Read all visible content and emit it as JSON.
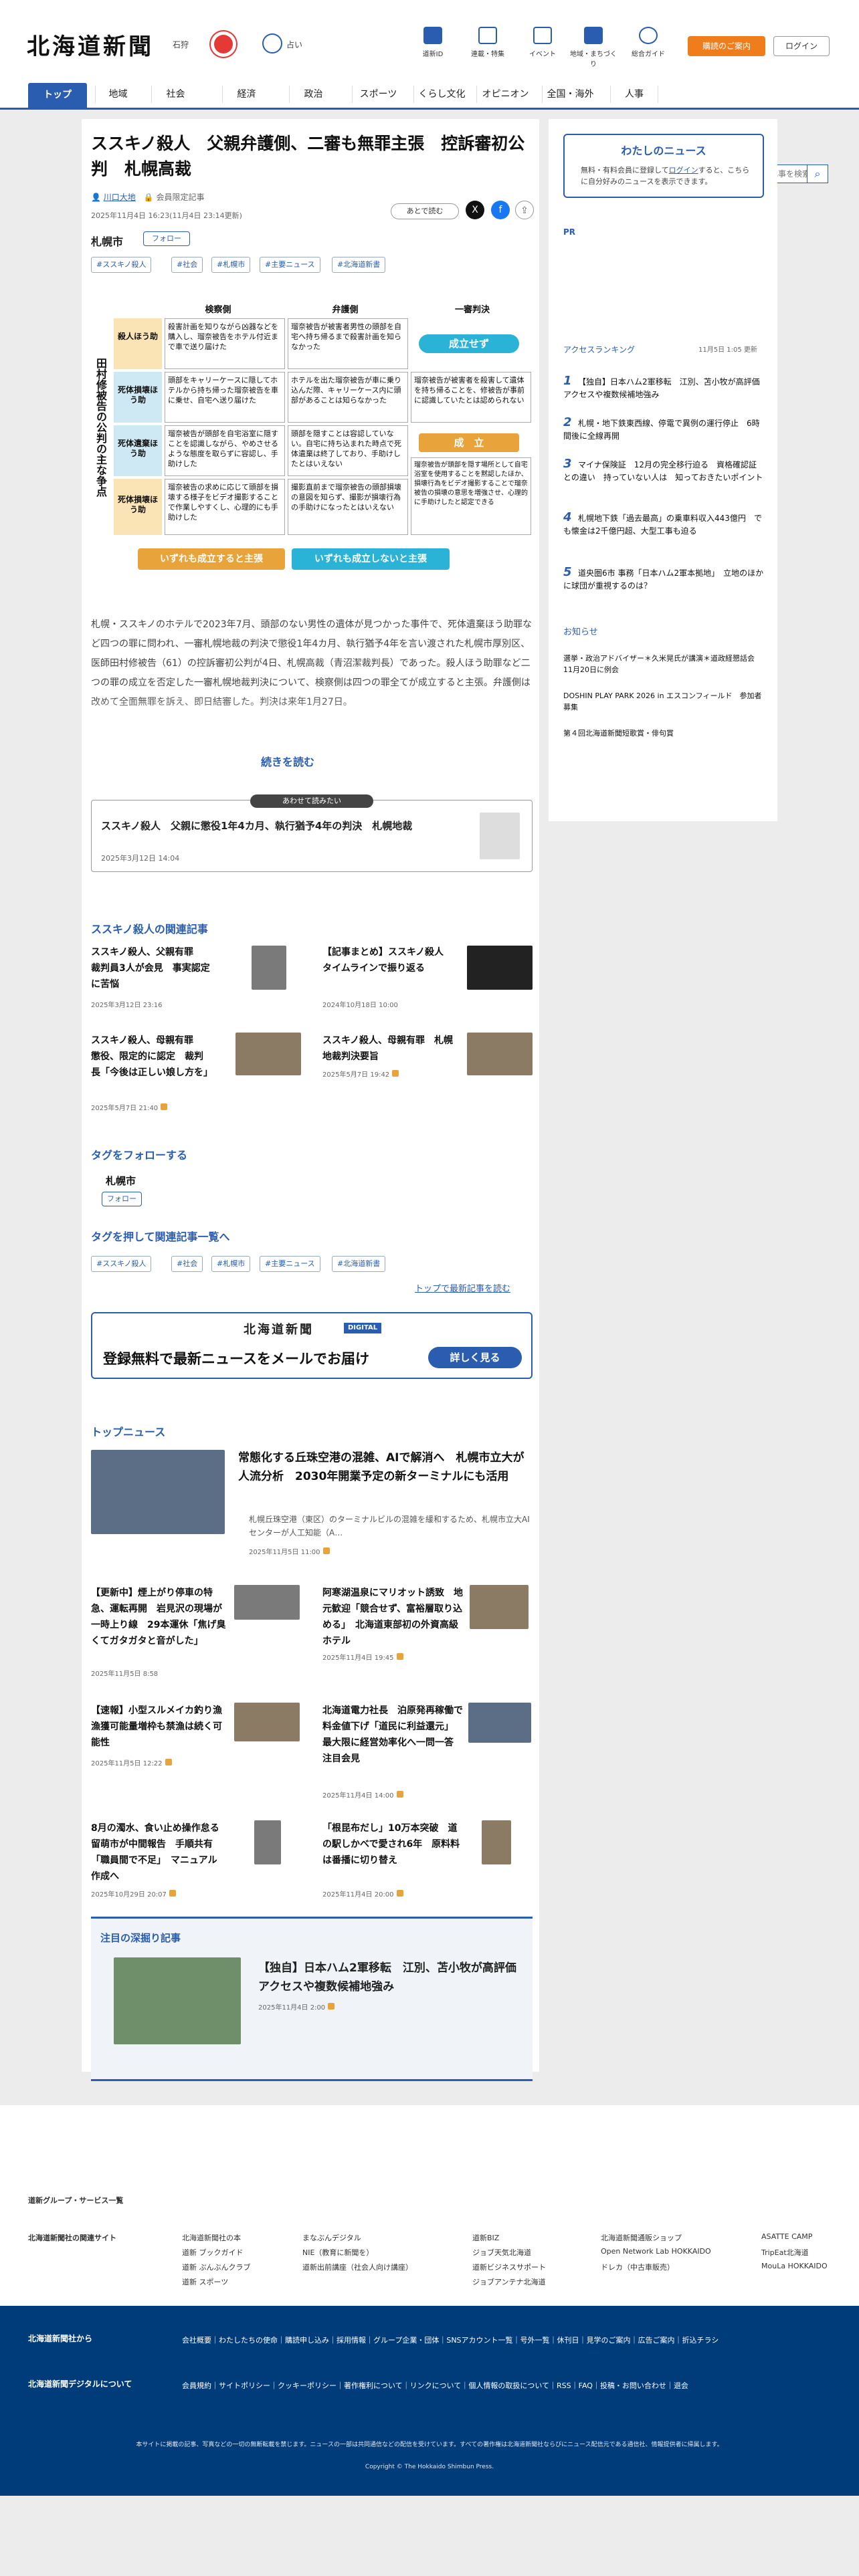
{
  "header": {
    "logo": "北海道新聞",
    "region": "石狩",
    "fortune": "占い",
    "nav": [
      "道新ID",
      "連載・特集",
      "イベント",
      "地域・まちづくり",
      "総合ガイド"
    ],
    "subscribe": "購読のご案内",
    "login": "ログイン"
  },
  "gnav": {
    "items": [
      "トップ",
      "地域",
      "社会",
      "経済",
      "政治",
      "スポーツ",
      "くらし文化",
      "オピニオン",
      "全国・海外",
      "人事"
    ],
    "search_placeholder": "記事を検索"
  },
  "article": {
    "title": "ススキノ殺人　父親弁護側、二審も無罪主張　控訴審初公判　札幌高裁",
    "author": "川口大地",
    "members": "会員限定記事",
    "date": "2025年11月4日 16:23(11月4日 23:14更新)",
    "read_later": "あとで読む",
    "city": "札幌市",
    "follow": "フォロー",
    "tags": [
      "#ススキノ殺人",
      "#社会",
      "#札幌市",
      "#主要ニュース",
      "#北海道新書"
    ],
    "table": {
      "side": "田村修被告の公判の主な争点",
      "cols": [
        "検察側",
        "弁護側",
        "一審判決"
      ],
      "rows": [
        {
          "label": "殺人ほう助",
          "pros": "殺害計画を知りながら凶器などを購入し、瑠奈被告をホテル付近まで車で送り届けた",
          "def": "瑠奈被告が被害者男性の頭部を自宅へ持ち帰るまで殺害計画を知らなかった",
          "ruling": "成立せず"
        },
        {
          "label": "死体損壊ほう助",
          "pros": "頭部をキャリーケースに隠してホテルから持ち帰った瑠奈被告を車に乗せ、自宅へ送り届けた",
          "def": "ホテルを出た瑠奈被告が車に乗り込んだ際、キャリーケース内に頭部があることは知らなかった",
          "ruling": "瑠奈被告が被害者を殺害して遺体を持ち帰ることを、修被告が事前に認識していたとは認められない"
        },
        {
          "label": "死体遺棄ほう助",
          "pros": "瑠奈被告が頭部を自宅浴室に隠すことを認識しながら、やめさせるような態度を取らずに容認し、手助けした",
          "def": "頭部を隠すことは容認していない。自宅に持ち込まれた時点で死体遺棄は終了しており、手助けしたとはいえない",
          "ruling": "成　立"
        },
        {
          "label": "死体損壊ほう助",
          "pros": "瑠奈被告の求めに応じて頭部を損壊する様子をビデオ撮影することで作業しやすくし、心理的にも手助けした",
          "def": "撮影直前まで瑠奈被告の頭部損壊の意図を知らず、撮影が損壊行為の手助けになったとはいえない",
          "ruling": "瑠奈被告が頭部を隠す場所として自宅浴室を使用することを黙認したほか、損壊行為をビデオ撮影することで瑠奈被告の損壊の意思を増強させ、心理的に手助けしたと認定できる"
        }
      ],
      "footer": [
        "いずれも成立すると主張",
        "いずれも成立しないと主張"
      ]
    },
    "body": "札幌・ススキノのホテルで2023年7月、頭部のない男性の遺体が見つかった事件で、死体遺棄ほう助罪など四つの罪に問われ、一審札幌地裁の判決で懲役1年4カ月、執行猶予4年を言い渡された札幌市厚別区、医師田村修被告（61）の控訴審初公判が4日、札幌高裁（青沼潔裁判長）であった。殺人ほう助罪など二つの罪の成立を否定した一審札幌地裁判決について、検察側は四つの罪全てが成立すると主張。弁護側は改めて全面無罪を訴え、即日結審した。判決は来年1月27日。",
    "read_more": "続きを読む"
  },
  "recommend": {
    "label": "あわせて読みたい",
    "title": "ススキノ殺人　父親に懲役1年4カ月、執行猶予4年の判決　札幌地裁",
    "date": "2025年3月12日 14:04"
  },
  "related": {
    "heading": "ススキノ殺人の関連記事",
    "items": [
      {
        "title": "ススキノ殺人、父親有罪　裁判員3人が会見　事実認定に苦悩",
        "date": "2025年3月12日 23:16"
      },
      {
        "title": "【記事まとめ】ススキノ殺人　タイムラインで振り返る",
        "date": "2024年10月18日 10:00"
      },
      {
        "title": "ススキノ殺人、母親有罪　懲役、限定的に認定　裁判長「今後は正しい娘し方を」",
        "date": "2025年5月7日 21:40"
      },
      {
        "title": "ススキノ殺人、母親有罪　札幌地裁判決要旨",
        "date": "2025年5月7日 19:42"
      }
    ]
  },
  "tagfollow": {
    "heading": "タグをフォローする",
    "city": "札幌市",
    "follow": "フォロー",
    "heading2": "タグを押して関連記事一覧へ",
    "back": "トップで最新記事を読む"
  },
  "banner": {
    "logo": "北海道新聞",
    "badge": "DIGITAL",
    "text": "登録無料で最新ニュースをメールでお届け",
    "btn": "詳しく見る"
  },
  "top": {
    "heading": "トップニュース",
    "lead": {
      "title": "常態化する丘珠空港の混雑、AIで解消へ　札幌市立大が人流分析　2030年開業予定の新ターミナルにも活用",
      "excerpt": "札幌丘珠空港（東区）のターミナルビルの混雑を緩和するため、札幌市立大AIセンターが人工知能（A…",
      "date": "2025年11月5日 11:00"
    },
    "items": [
      {
        "title": "【更新中】煙上がり停車の特急、運転再開　岩見沢の現場が一時上り線　29本運休「焦げ臭くてガタガタと音がした」",
        "date": "2025年11月5日 8:58"
      },
      {
        "title": "阿寒湖温泉にマリオット誘致　地元歓迎「競合せず、富裕層取り込める」　北海道東部初の外資高級ホテル",
        "date": "2025年11月4日 19:45"
      },
      {
        "title": "【速報】小型スルメイカ釣り漁　漁獲可能量増枠も禁漁は続く可能性",
        "date": "2025年11月5日 12:22"
      },
      {
        "title": "北海道電力社長　泊原発再稼働で料金値下げ「道民に利益還元」　最大限に経営効率化へ一問一答　注目会見",
        "date": "2025年11月4日 14:00"
      },
      {
        "title": "8月の濁水、食い止め操作怠る　留萌市が中間報告　手順共有「職員間で不足」　マニュアル作成へ",
        "date": "2025年10月29日 20:07"
      },
      {
        "title": "「根昆布だし」10万本突破　道の駅しかべで愛され6年　原料料は番播に切り替え",
        "date": "2025年11月4日 20:00"
      }
    ]
  },
  "deep": {
    "heading": "注目の深掘り記事",
    "title": "【独自】日本ハム2軍移転　江別、苫小牧が高評価　アクセスや複数候補地強み",
    "date": "2025年11月4日 2:00"
  },
  "side": {
    "mynews": "わたしのニュース",
    "mynews_text": "無料・有料会員に登録して",
    "login": "ログイン",
    "mynews_text2": "すると、こちらに自分好みのニュースを表示できます。",
    "pr": "PR",
    "ranking": "アクセスランキング",
    "ranking_date": "11月5日 1:05 更新",
    "ranks": [
      "【独自】日本ハム2軍移転　江別、苫小牧が高評価　アクセスや複数候補地強み",
      "札幌・地下鉄東西線、停電で異例の運行停止　6時間後に全線再開",
      "マイナ保険証　12月の完全移行迫る　資格確認証との違い　持っていない人は　知っておきたいポイント",
      "札幌地下鉄「過去最高」の乗車料収入443億円　でも懐金は2千億円超、大型工事も迫る",
      "道央圏6市 事務「日本ハム2軍本拠地」　立地のほかに球団が重視するのは？"
    ],
    "notice": "お知らせ",
    "notices": [
      "選挙・政治アドバイザー＊久米晃氏が講演＊道政経懇話会 11月20日に例会",
      "DOSHIN PLAY PARK 2026 in エスコンフィールド　参加者募集",
      "第４回北海道新聞短歌賞・俳句賞"
    ]
  },
  "footer": {
    "group": "道新グループ・サービス一覧",
    "related": "北海道新聞社の関連サイト",
    "sites": [
      "北海道新聞社の本",
      "まなぶんデジタル",
      "道新BIZ",
      "北海道新聞通販ショップ",
      "ASATTE CAMP",
      "道新 ブックガイド",
      "NIE（教育に新聞を）",
      "ジョブ天気北海道",
      "Open Network Lab HOKKAIDO",
      "TripEat北海道",
      "道新 ぶんぶんクラブ",
      "道新出前講座（社会人向け講座）",
      "道新ビジネスサポート",
      "ドレカ（中古車販売）",
      "MouLa HOKKAIDO",
      "道新 スポーツ",
      "",
      "ジョブアンテナ北海道",
      "",
      ""
    ],
    "company": "北海道新聞社から",
    "company_links": [
      "会社概要",
      "わたしたちの使命",
      "購読申し込み",
      "採用情報",
      "グループ企業・団体",
      "SNSアカウント一覧",
      "号外一覧",
      "休刊日",
      "見学のご案内",
      "広告ご案内",
      "折込チラシ"
    ],
    "digital": "北海道新聞デジタルについて",
    "digital_links": [
      "会員規約",
      "サイトポリシー",
      "クッキーポリシー",
      "著作権利について",
      "リンクについて",
      "個人情報の取扱について",
      "RSS",
      "FAQ",
      "投稿・お問い合わせ",
      "退会"
    ],
    "notice": "本サイトに掲載の記事、写真などの一切の無断転載を禁じます。ニュースの一部は共同通信などの配信を受けています。すべての著作権は北海道新聞社ならびにニュース配信元である通信社、情報提供者に帰属します。",
    "copy": "Copyright © The Hokkaido Shimbun Press."
  },
  "colors": {
    "brand": "#2a5db0",
    "accent": "#ef7d1b",
    "footer": "#003b7a"
  }
}
